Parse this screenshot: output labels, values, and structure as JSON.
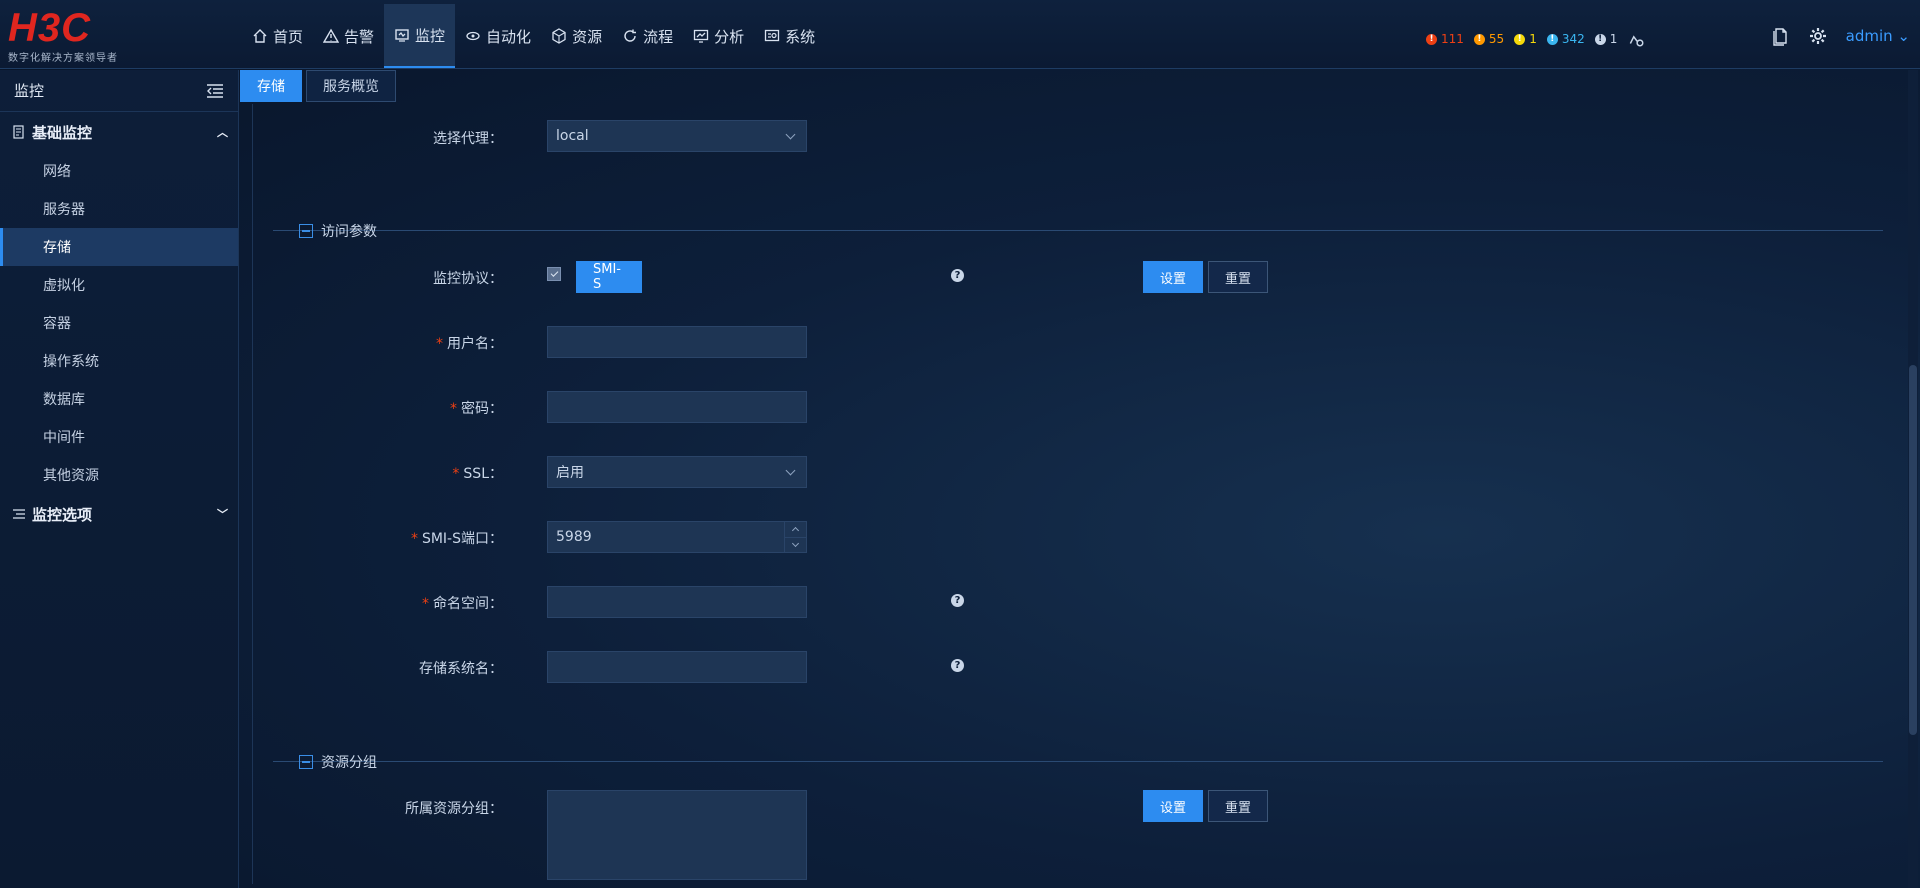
{
  "brand": {
    "logo": "H3C",
    "slogan": "数字化解决方案领导者"
  },
  "nav": [
    {
      "label": "首页",
      "icon": "home-icon"
    },
    {
      "label": "告警",
      "icon": "warning-icon"
    },
    {
      "label": "监控",
      "icon": "monitor-icon",
      "active": true
    },
    {
      "label": "自动化",
      "icon": "automation-icon"
    },
    {
      "label": "资源",
      "icon": "resource-icon"
    },
    {
      "label": "流程",
      "icon": "process-icon"
    },
    {
      "label": "分析",
      "icon": "analysis-icon"
    },
    {
      "label": "系统",
      "icon": "system-icon"
    }
  ],
  "alarms": [
    {
      "count": "111",
      "color": "#ed4014"
    },
    {
      "count": "55",
      "color": "#ff9900"
    },
    {
      "count": "1",
      "color": "#f5d90a"
    },
    {
      "count": "342",
      "color": "#3ab6f0"
    },
    {
      "count": "1",
      "color": "#c9d6e8"
    }
  ],
  "user": {
    "name": "admin"
  },
  "sidebar": {
    "title": "监控",
    "group1": "基础监控",
    "items": [
      "网络",
      "服务器",
      "存储",
      "虚拟化",
      "容器",
      "操作系统",
      "数据库",
      "中间件",
      "其他资源"
    ],
    "active_item": "存储",
    "group2": "监控选项"
  },
  "tabs": [
    {
      "label": "存储",
      "active": true
    },
    {
      "label": "服务概览",
      "active": false
    }
  ],
  "form": {
    "proxy_label": "选择代理：",
    "proxy_value": "local",
    "section_access": "访问参数",
    "protocol_label": "监控协议：",
    "protocol_value": "SMI-S",
    "set_label": "设置",
    "reset_label": "重置",
    "username_label": "用户名：",
    "password_label": "密码：",
    "ssl_label": "SSL：",
    "ssl_value": "启用",
    "port_label": "SMI-S端口：",
    "port_value": "5989",
    "namespace_label": "命名空间：",
    "storage_name_label": "存储系统名：",
    "section_group": "资源分组",
    "group_label": "所属资源分组：",
    "required_mark": "*"
  }
}
